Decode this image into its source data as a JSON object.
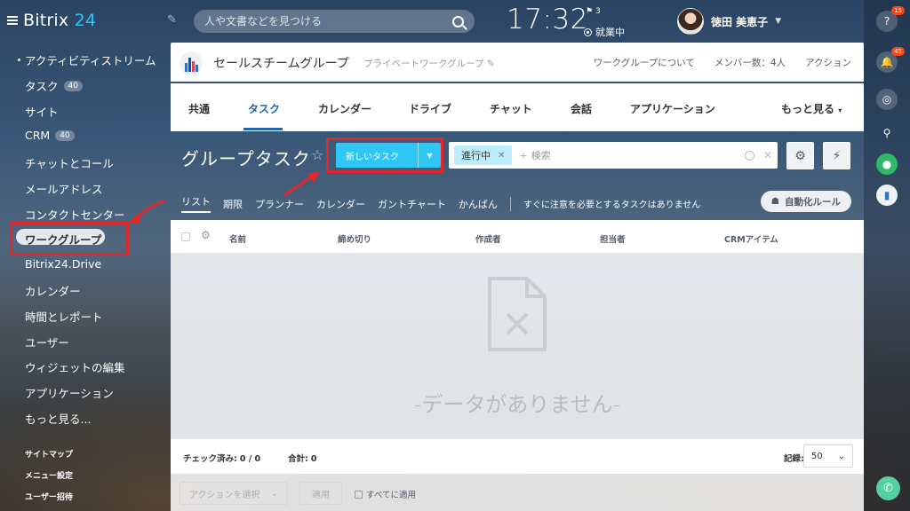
{
  "app": {
    "logo_prefix": "Bitrix",
    "logo_number": "24"
  },
  "topbar": {
    "search_placeholder": "人や文書などを見つける",
    "clock": "17:32",
    "flag_count": "3",
    "work_status": "就業中",
    "user_name": "徳田 美恵子"
  },
  "sidebar": {
    "items": [
      {
        "label": "アクティビティストリーム",
        "badge": ""
      },
      {
        "label": "タスク",
        "badge": "40"
      },
      {
        "label": "サイト",
        "badge": ""
      },
      {
        "label": "CRM",
        "badge": "40"
      },
      {
        "label": "チャットとコール",
        "badge": ""
      },
      {
        "label": "メールアドレス",
        "badge": ""
      },
      {
        "label": "コンタクトセンター",
        "badge": ""
      },
      {
        "label": "ワークグループ",
        "badge": ""
      },
      {
        "label": "Bitrix24.Drive",
        "badge": ""
      },
      {
        "label": "カレンダー",
        "badge": ""
      },
      {
        "label": "時間とレポート",
        "badge": ""
      },
      {
        "label": "ユーザー",
        "badge": ""
      },
      {
        "label": "ウィジェットの編集",
        "badge": ""
      },
      {
        "label": "アプリケーション",
        "badge": ""
      },
      {
        "label": "もっと見る...",
        "badge": ""
      }
    ],
    "footer_links": [
      "サイトマップ",
      "メニュー設定",
      "ユーザー招待"
    ]
  },
  "group": {
    "title": "セールスチームグループ",
    "type": "プライベートワークグループ",
    "links": [
      "ワークグループについて",
      "メンバー数：4人",
      "アクション"
    ]
  },
  "tabs": [
    "共通",
    "タスク",
    "カレンダー",
    "ドライブ",
    "チャット",
    "会話",
    "アプリケーション",
    "もっと見る"
  ],
  "tasks": {
    "page_title": "グループタスク",
    "new_task_label": "新しいタスク",
    "filter_chip": "進行中",
    "filter_placeholder": "検索",
    "view_tabs": [
      "リスト",
      "期限",
      "プランナー",
      "カレンダー",
      "ガントチャート",
      "かんばん"
    ],
    "attention_text": "すぐに注意を必要とするタスクはありません",
    "rules_label": "自動化ルール"
  },
  "grid": {
    "columns": [
      "名前",
      "締め切り",
      "作成者",
      "担当者",
      "CRMアイテム"
    ],
    "empty_text": "-データがありません-",
    "checked_label": "チェック済み:",
    "checked_value": "0 / 0",
    "total_label": "合計:",
    "total_value": "0",
    "records_label": "記録:",
    "page_size": "50",
    "action_select": "アクションを選択",
    "apply_label": "適用",
    "apply_all_label": "すべてに適用"
  },
  "rightbar": {
    "help_badge": "15",
    "notify_badge": "45"
  },
  "colors": {
    "accent": "#2fc6f6",
    "tab_active": "#2067b0",
    "highlight_box": "#e5262b"
  }
}
